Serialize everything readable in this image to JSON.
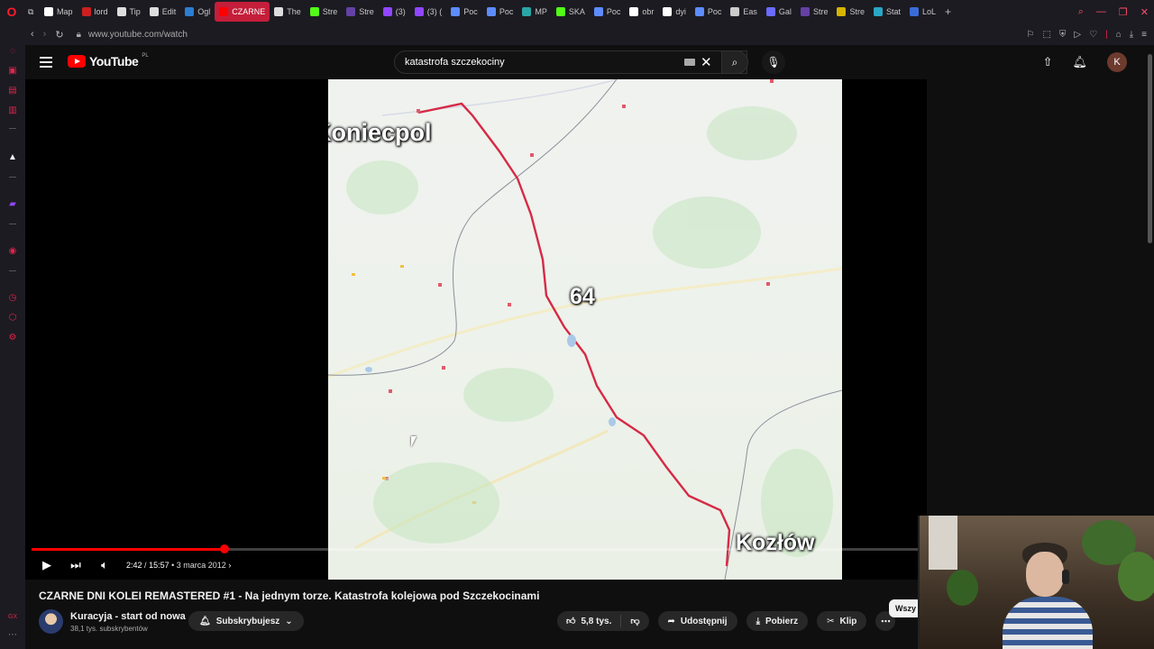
{
  "browser": {
    "tabs": [
      {
        "label": "Map",
        "color": "#ffffff"
      },
      {
        "label": "lord",
        "color": "#cc2020"
      },
      {
        "label": "Tip",
        "color": "#dddddd"
      },
      {
        "label": "Edit",
        "color": "#dddddd"
      },
      {
        "label": "Ogl",
        "color": "#2d7dd2"
      },
      {
        "label": "CZARNE",
        "color": "#ff0000",
        "active": true
      },
      {
        "label": "The",
        "color": "#dddddd"
      },
      {
        "label": "Stre",
        "color": "#53fc18"
      },
      {
        "label": "Stre",
        "color": "#6441a5"
      },
      {
        "label": "(3) ",
        "color": "#9146ff"
      },
      {
        "label": "(3) (",
        "color": "#9146ff"
      },
      {
        "label": "Poc",
        "color": "#5d8cff"
      },
      {
        "label": "Poc",
        "color": "#5d8cff"
      },
      {
        "label": "MP",
        "color": "#2aa6a6"
      },
      {
        "label": "SKA",
        "color": "#53fc18"
      },
      {
        "label": "Poc",
        "color": "#5d8cff"
      },
      {
        "label": "obr",
        "color": "#ffffff"
      },
      {
        "label": "dyi",
        "color": "#ffffff"
      },
      {
        "label": "Poc",
        "color": "#5d8cff"
      },
      {
        "label": "Eas",
        "color": "#cccccc"
      },
      {
        "label": "Gal",
        "color": "#6b6bff"
      },
      {
        "label": "Stre",
        "color": "#6441a5"
      },
      {
        "label": "Stre",
        "color": "#d6b400"
      },
      {
        "label": "Stat",
        "color": "#2aa6c6"
      },
      {
        "label": "LoL",
        "color": "#3a6cd6"
      }
    ],
    "url": "www.youtube.com/watch"
  },
  "header": {
    "logo_text": "YouTube",
    "logo_region": "PL",
    "search_value": "katastrofa szczekociny",
    "avatar_letter": "K"
  },
  "player": {
    "map_labels": {
      "start_city": "Koniecpol",
      "line_number": "64",
      "end_city": "Kozłów"
    },
    "time_current": "2:42",
    "time_total": "15:57",
    "time_separator": "/",
    "upload_date": "3 marca 2012",
    "progress_fraction": 0.2165
  },
  "video": {
    "title": "CZARNE DNI KOLEI REMASTERED #1 - Na jednym torze. Katastrofa kolejowa pod Szczekocinami",
    "channel_name": "Kuracyja - start od nowa",
    "channel_subs": "38,1 tys. subskrybentów",
    "subscribe_label": "Subskrybujesz",
    "like_count": "5,8 tys.",
    "share_label": "Udostępnij",
    "download_label": "Pobierz",
    "clip_label": "Klip",
    "chip_all_label": "Wszy"
  },
  "colors": {
    "accent": "#ff0000",
    "browser_accent": "#e0244a",
    "route_line": "#d62a45"
  }
}
